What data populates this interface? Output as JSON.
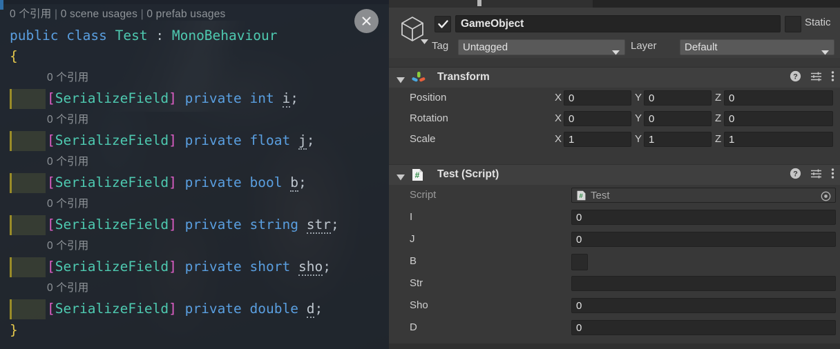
{
  "editor": {
    "usage_header": {
      "references": "0 个引用",
      "scene": "0 scene usages",
      "prefab": "0 prefab usages",
      "sep": "|"
    },
    "close_icon": "close-icon",
    "lines": [
      {
        "type": "code",
        "tokens": [
          {
            "t": "public ",
            "c": "kw"
          },
          {
            "t": "class ",
            "c": "kw"
          },
          {
            "t": "Test",
            "c": "typ"
          },
          {
            "t": " : ",
            "c": "pun"
          },
          {
            "t": "MonoBehaviour",
            "c": "typ"
          }
        ]
      },
      {
        "type": "code",
        "tokens": [
          {
            "t": "{",
            "c": "brace"
          }
        ]
      },
      {
        "type": "hint",
        "text": "0 个引用"
      },
      {
        "type": "field",
        "attr": "[SerializeField]",
        "modifier": "private",
        "vartype": "int",
        "name": "i",
        "semi": ";"
      },
      {
        "type": "hint",
        "text": "0 个引用"
      },
      {
        "type": "field",
        "attr": "[SerializeField]",
        "modifier": "private",
        "vartype": "float",
        "name": "j",
        "semi": ";"
      },
      {
        "type": "hint",
        "text": "0 个引用"
      },
      {
        "type": "field",
        "attr": "[SerializeField]",
        "modifier": "private",
        "vartype": "bool",
        "name": "b",
        "semi": ";"
      },
      {
        "type": "hint",
        "text": "0 个引用"
      },
      {
        "type": "field",
        "attr": "[SerializeField]",
        "modifier": "private",
        "vartype": "string",
        "name": "str",
        "semi": ";"
      },
      {
        "type": "hint",
        "text": "0 个引用"
      },
      {
        "type": "field",
        "attr": "[SerializeField]",
        "modifier": "private",
        "vartype": "short",
        "name": "sho",
        "semi": ";"
      },
      {
        "type": "hint",
        "text": "0 个引用"
      },
      {
        "type": "field",
        "attr": "[SerializeField]",
        "modifier": "private",
        "vartype": "double",
        "name": "d",
        "semi": ";"
      },
      {
        "type": "code",
        "tokens": [
          {
            "t": "}",
            "c": "brace"
          }
        ]
      }
    ]
  },
  "inspector": {
    "gameobject": {
      "icon": "cube-icon",
      "enabled_checkbox": "checked",
      "name": "GameObject",
      "static_label": "Static",
      "tag_label": "Tag",
      "tag_value": "Untagged",
      "layer_label": "Layer",
      "layer_value": "Default"
    },
    "components": [
      {
        "title": "Transform",
        "icon": "transform-gizmo-icon",
        "header_icons": [
          "help-icon",
          "preset-icon",
          "more-menu-icon"
        ],
        "rows": [
          {
            "label": "Position",
            "axes": [
              {
                "axis": "X",
                "value": "0"
              },
              {
                "axis": "Y",
                "value": "0"
              },
              {
                "axis": "Z",
                "value": "0"
              }
            ]
          },
          {
            "label": "Rotation",
            "axes": [
              {
                "axis": "X",
                "value": "0"
              },
              {
                "axis": "Y",
                "value": "0"
              },
              {
                "axis": "Z",
                "value": "0"
              }
            ]
          },
          {
            "label": "Scale",
            "link_icon": "link-broken-icon",
            "axes": [
              {
                "axis": "X",
                "value": "1"
              },
              {
                "axis": "Y",
                "value": "1"
              },
              {
                "axis": "Z",
                "value": "1"
              }
            ]
          }
        ]
      },
      {
        "title": "Test (Script)",
        "icon": "csharp-script-icon",
        "header_icons": [
          "help-icon",
          "preset-icon",
          "more-menu-icon"
        ],
        "rows": [
          {
            "label": "Script",
            "kind": "object",
            "value": "Test",
            "dim": true,
            "picker": "object-picker-icon"
          },
          {
            "label": "I",
            "kind": "number",
            "value": "0"
          },
          {
            "label": "J",
            "kind": "number",
            "value": "0"
          },
          {
            "label": "B",
            "kind": "boolean",
            "value": ""
          },
          {
            "label": "Str",
            "kind": "text",
            "value": ""
          },
          {
            "label": "Sho",
            "kind": "number",
            "value": "0"
          },
          {
            "label": "D",
            "kind": "number",
            "value": "0"
          }
        ]
      }
    ]
  },
  "colors": {
    "inspector_bg": "#383838",
    "header_bg": "#3c3c3c",
    "field_bg": "#282828",
    "editor_bg": "#242a33",
    "keyword": "#5a9fe0",
    "type": "#4ec9b0",
    "bracket": "#e05fc8",
    "brace": "#e6c84c",
    "hint_text": "#8f9499"
  }
}
